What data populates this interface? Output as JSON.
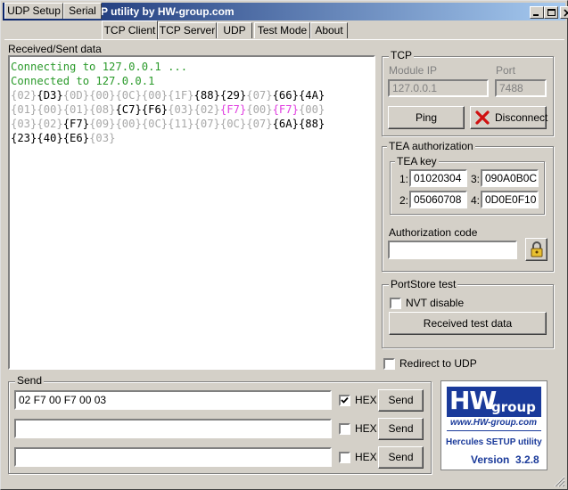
{
  "window": {
    "title": "Hercules SETUP utility by HW-group.com",
    "icon": "hercules-app-icon",
    "controls": [
      "minimize-icon",
      "maximize-icon",
      "close-icon"
    ]
  },
  "tabs": [
    {
      "label": "UDP Setup"
    },
    {
      "label": "Serial"
    },
    {
      "label": "TCP Client",
      "active": true
    },
    {
      "label": "TCP Server"
    },
    {
      "label": "UDP"
    },
    {
      "label": "Test Mode"
    },
    {
      "label": "About"
    }
  ],
  "received": {
    "label": "Received/Sent data",
    "lines": [
      [
        {
          "t": "Connecting to 127.0.0.1 ...",
          "c": "g"
        }
      ],
      [
        {
          "t": "Connected to 127.0.0.1",
          "c": "g"
        }
      ],
      [
        {
          "t": "{02}",
          "c": "d"
        },
        {
          "t": "{D3}",
          "c": "k"
        },
        {
          "t": "{0D}",
          "c": "d"
        },
        {
          "t": "{00}",
          "c": "d"
        },
        {
          "t": "{0C}",
          "c": "d"
        },
        {
          "t": "{00}",
          "c": "d"
        },
        {
          "t": "{1F}",
          "c": "d"
        },
        {
          "t": "{88}",
          "c": "k"
        },
        {
          "t": "{29}",
          "c": "k"
        },
        {
          "t": "{07}",
          "c": "d"
        },
        {
          "t": "{66}",
          "c": "k"
        },
        {
          "t": "{4A}",
          "c": "k"
        }
      ],
      [
        {
          "t": "{01}",
          "c": "d"
        },
        {
          "t": "{00}",
          "c": "d"
        },
        {
          "t": "{01}",
          "c": "d"
        },
        {
          "t": "{08}",
          "c": "d"
        },
        {
          "t": "{C7}",
          "c": "k"
        },
        {
          "t": "{F6}",
          "c": "k"
        },
        {
          "t": "{03}",
          "c": "d"
        },
        {
          "t": "{02}",
          "c": "d"
        },
        {
          "t": "{F7}",
          "c": "m"
        },
        {
          "t": "{00}",
          "c": "d"
        },
        {
          "t": "{F7}",
          "c": "m"
        },
        {
          "t": "{00}",
          "c": "d"
        }
      ],
      [
        {
          "t": "{03}",
          "c": "d"
        },
        {
          "t": "{02}",
          "c": "d"
        },
        {
          "t": "{F7}",
          "c": "k"
        },
        {
          "t": "{09}",
          "c": "d"
        },
        {
          "t": "{00}",
          "c": "d"
        },
        {
          "t": "{0C}",
          "c": "d"
        },
        {
          "t": "{11}",
          "c": "d"
        },
        {
          "t": "{07}",
          "c": "d"
        },
        {
          "t": "{0C}",
          "c": "d"
        },
        {
          "t": "{07}",
          "c": "d"
        },
        {
          "t": "{6A}",
          "c": "k"
        },
        {
          "t": "{88}",
          "c": "k"
        }
      ],
      [
        {
          "t": "{23}",
          "c": "k"
        },
        {
          "t": "{40}",
          "c": "k"
        },
        {
          "t": "{E6}",
          "c": "k"
        },
        {
          "t": "{03}",
          "c": "d"
        }
      ]
    ]
  },
  "tcp": {
    "group_label": "TCP",
    "module_ip_label": "Module IP",
    "module_ip_value": "127.0.0.1",
    "port_label": "Port",
    "port_value": "7488",
    "ping_label": "Ping",
    "disconnect_label": "Disconnect"
  },
  "tea": {
    "group_label": "TEA authorization",
    "key_label": "TEA key",
    "keys": [
      {
        "index": "1:",
        "value": "01020304"
      },
      {
        "index": "3:",
        "value": "090A0B0C"
      },
      {
        "index": "2:",
        "value": "05060708"
      },
      {
        "index": "4:",
        "value": "0D0E0F10"
      }
    ],
    "auth_code_label": "Authorization code",
    "auth_code_value": ""
  },
  "portstore": {
    "group_label": "PortStore test",
    "nvt_label": "NVT disable",
    "nvt_checked": false,
    "received_test_label": "Received test data"
  },
  "redirect": {
    "label": "Redirect to UDP",
    "checked": false
  },
  "send": {
    "group_label": "Send",
    "rows": [
      {
        "value": "02 F7 00 F7 00 03",
        "hex_label": "HEX",
        "hex_checked": true,
        "button": "Send"
      },
      {
        "value": "",
        "hex_label": "HEX",
        "hex_checked": false,
        "button": "Send"
      },
      {
        "value": "",
        "hex_label": "HEX",
        "hex_checked": false,
        "button": "Send"
      }
    ]
  },
  "logo": {
    "brand_hw": "HW",
    "brand_group": "group",
    "url": "www.HW-group.com",
    "product": "Hercules SETUP utility",
    "version": "Version  3.2.8",
    "brand_color": "#1a3a9a"
  }
}
